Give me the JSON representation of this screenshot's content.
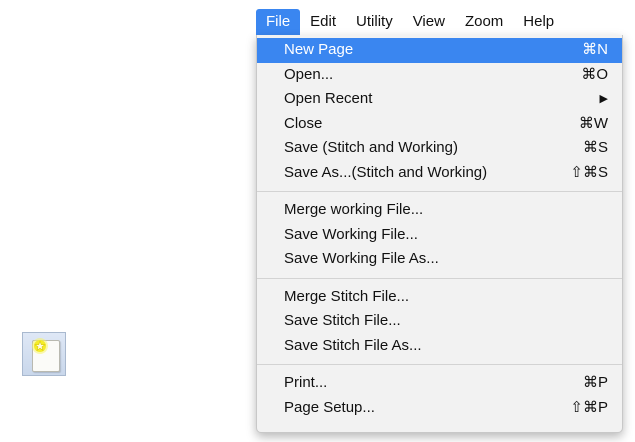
{
  "menubar": {
    "items": [
      "File",
      "Edit",
      "Utility",
      "View",
      "Zoom",
      "Help"
    ]
  },
  "file_menu": {
    "groups": [
      [
        {
          "label": "New Page",
          "shortcut": "⌘N"
        },
        {
          "label": "Open...",
          "shortcut": "⌘O"
        },
        {
          "label": "Open Recent",
          "submenu_arrow": "▶"
        },
        {
          "label": "Close",
          "shortcut": "⌘W"
        },
        {
          "label": "Save (Stitch and Working)",
          "shortcut": "⌘S"
        },
        {
          "label": "Save As...(Stitch and Working)",
          "shortcut": "⇧⌘S"
        }
      ],
      [
        {
          "label": "Merge working File..."
        },
        {
          "label": "Save Working File..."
        },
        {
          "label": "Save Working File As..."
        }
      ],
      [
        {
          "label": "Merge Stitch File..."
        },
        {
          "label": "Save Stitch File..."
        },
        {
          "label": "Save Stitch File As..."
        }
      ],
      [
        {
          "label": "Print...",
          "shortcut": "⌘P"
        },
        {
          "label": "Page Setup...",
          "shortcut": "⇧⌘P"
        }
      ]
    ],
    "highlighted_item": "New Page"
  },
  "icons": {
    "new_page_icon": "new-page-icon"
  },
  "colors": {
    "accent": "#3a86f0",
    "menu_bg": "#f2f2f2"
  }
}
